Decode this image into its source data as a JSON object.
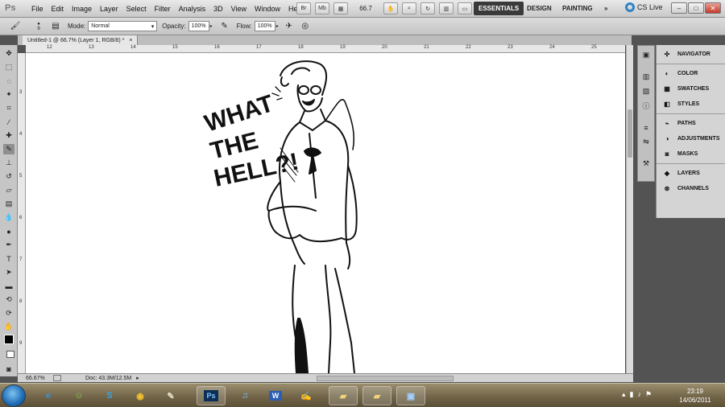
{
  "app": {
    "logo": "Ps"
  },
  "menu": [
    "File",
    "Edit",
    "Image",
    "Layer",
    "Select",
    "Filter",
    "Analysis",
    "3D",
    "View",
    "Window",
    "Help"
  ],
  "menubar_tools": {
    "br_label": "Br",
    "mb_label": "Mb",
    "zoom": "66.7"
  },
  "workspaces": [
    "ESSENTIALS",
    "DESIGN",
    "PAINTING",
    "»"
  ],
  "cs_live": "CS Live",
  "options": {
    "brush_size": "9",
    "mode_label": "Mode:",
    "mode_value": "Normal",
    "opacity_label": "Opacity:",
    "opacity_value": "100%",
    "flow_label": "Flow:",
    "flow_value": "100%"
  },
  "document": {
    "tab_title": "Untitled-1 @ 66.7% (Layer 1, RGB/8) *",
    "close": "×"
  },
  "ruler_h_labels": [
    "12",
    "13",
    "14",
    "15",
    "16",
    "17",
    "18",
    "19",
    "20",
    "21",
    "22",
    "23",
    "24",
    "25"
  ],
  "ruler_v_labels": [
    "3",
    "4",
    "5",
    "6",
    "7",
    "8",
    "9"
  ],
  "drawing": {
    "text_lines": [
      "WHAT",
      "THE",
      "HELL?!"
    ]
  },
  "status": {
    "zoom": "66.67%",
    "doc": "Doc: 43.3M/12.5M"
  },
  "panels": {
    "groups": [
      [
        "NAVIGATOR"
      ],
      [
        "COLOR",
        "SWATCHES",
        "STYLES"
      ],
      [
        "PATHS",
        "ADJUSTMENTS",
        "MASKS"
      ],
      [
        "LAYERS",
        "CHANNELS"
      ]
    ]
  },
  "taskbar": {
    "apps": [
      "ie-icon",
      "messenger-icon",
      "skype-icon",
      "chrome-icon",
      "brush-app-icon",
      "photoshop-icon",
      "itunes-icon",
      "word-icon",
      "notes-icon",
      "folder-icon",
      "folder2-icon",
      "display-icon"
    ],
    "ps_label": "Ps",
    "word_label": "W",
    "time": "23:19",
    "date": "14/06/2011"
  }
}
